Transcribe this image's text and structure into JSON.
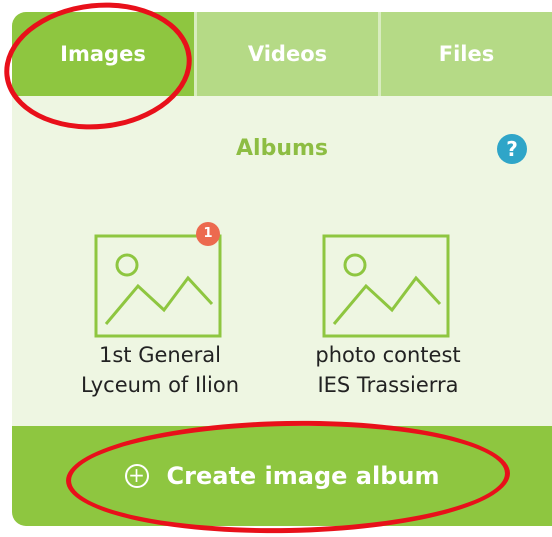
{
  "tabs": [
    {
      "label": "Images",
      "active": true
    },
    {
      "label": "Videos",
      "active": false
    },
    {
      "label": "Files",
      "active": false
    }
  ],
  "albums_section": {
    "title": "Albums",
    "help_icon": "question-mark-icon",
    "help_glyph": "?"
  },
  "albums": [
    {
      "name_line1": "1st General",
      "name_line2": "Lyceum of Ilion",
      "badge": "1",
      "thumbnail_icon": "image-placeholder-icon"
    },
    {
      "name_line1": "photo contest",
      "name_line2": "IES Trassierra",
      "thumbnail_icon": "image-placeholder-icon"
    }
  ],
  "create_button": {
    "label": "Create image album",
    "icon": "plus-circle-icon",
    "glyph": "+"
  },
  "colors": {
    "primary_green": "#8ec640",
    "light_green": "#b5da86",
    "panel_background": "#eef6e2",
    "title_green": "#8dbd43",
    "help_blue": "#2fa5c8",
    "badge_red": "#ec6a4f",
    "annotation_red": "#e8101a"
  }
}
